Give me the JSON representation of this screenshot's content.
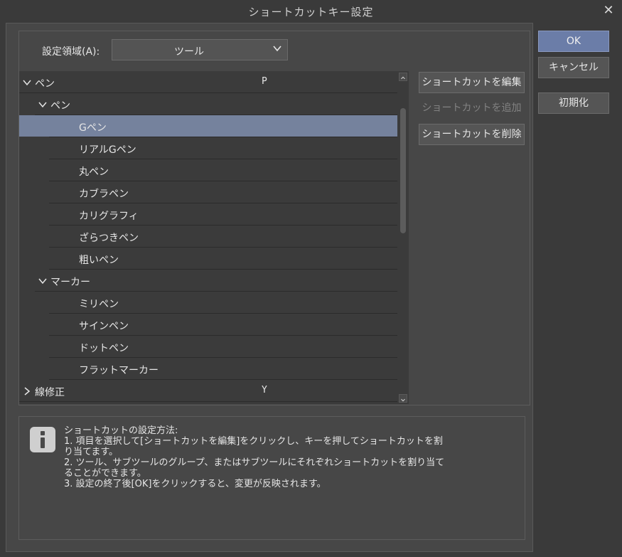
{
  "window": {
    "title": "ショートカットキー設定"
  },
  "area": {
    "label": "設定領域(A):",
    "selected": "ツール"
  },
  "tree": [
    {
      "label": "ペン",
      "key": "P",
      "level": 0,
      "expanded": true,
      "selected": false
    },
    {
      "label": "ペン",
      "key": "",
      "level": 1,
      "expanded": true,
      "selected": false
    },
    {
      "label": "Gペン",
      "key": "",
      "level": 2,
      "selected": true
    },
    {
      "label": "リアルGペン",
      "key": "",
      "level": 2,
      "selected": false
    },
    {
      "label": "丸ペン",
      "key": "",
      "level": 2,
      "selected": false
    },
    {
      "label": "カブラペン",
      "key": "",
      "level": 2,
      "selected": false
    },
    {
      "label": "カリグラフィ",
      "key": "",
      "level": 2,
      "selected": false
    },
    {
      "label": "ざらつきペン",
      "key": "",
      "level": 2,
      "selected": false
    },
    {
      "label": "粗いペン",
      "key": "",
      "level": 2,
      "selected": false
    },
    {
      "label": "マーカー",
      "key": "",
      "level": 1,
      "expanded": true,
      "selected": false
    },
    {
      "label": "ミリペン",
      "key": "",
      "level": 2,
      "selected": false
    },
    {
      "label": "サインペン",
      "key": "",
      "level": 2,
      "selected": false
    },
    {
      "label": "ドットペン",
      "key": "",
      "level": 2,
      "selected": false
    },
    {
      "label": "フラットマーカー",
      "key": "",
      "level": 2,
      "selected": false
    },
    {
      "label": "線修正",
      "key": "Y",
      "level": 0,
      "expanded": false,
      "selected": false
    }
  ],
  "shortcut_buttons": {
    "edit": "ショートカットを編集",
    "add": "ショートカットを追加",
    "delete": "ショートカットを削除"
  },
  "info": {
    "heading": "ショートカットの設定方法:",
    "line1a": "1. 項目を選択して[ショートカットを編集]をクリックし、キーを押してショートカットを割",
    "line1b": "り当てます。",
    "line2a": "2. ツール、サブツールのグループ、またはサブツールにそれぞれショートカットを割り当て",
    "line2b": "ることができます。",
    "line3": "3. 設定の終了後[OK]をクリックすると、変更が反映されます。"
  },
  "dialog_buttons": {
    "ok": "OK",
    "cancel": "キャンセル",
    "reset": "初期化"
  },
  "colors": {
    "selection": "#75829d",
    "primary_button": "#6b7da8",
    "background": "#3a3a3a"
  },
  "icons": {
    "close": "close-icon",
    "expanded": "chevron-down-icon",
    "collapsed": "chevron-right-icon",
    "info": "info-icon"
  }
}
